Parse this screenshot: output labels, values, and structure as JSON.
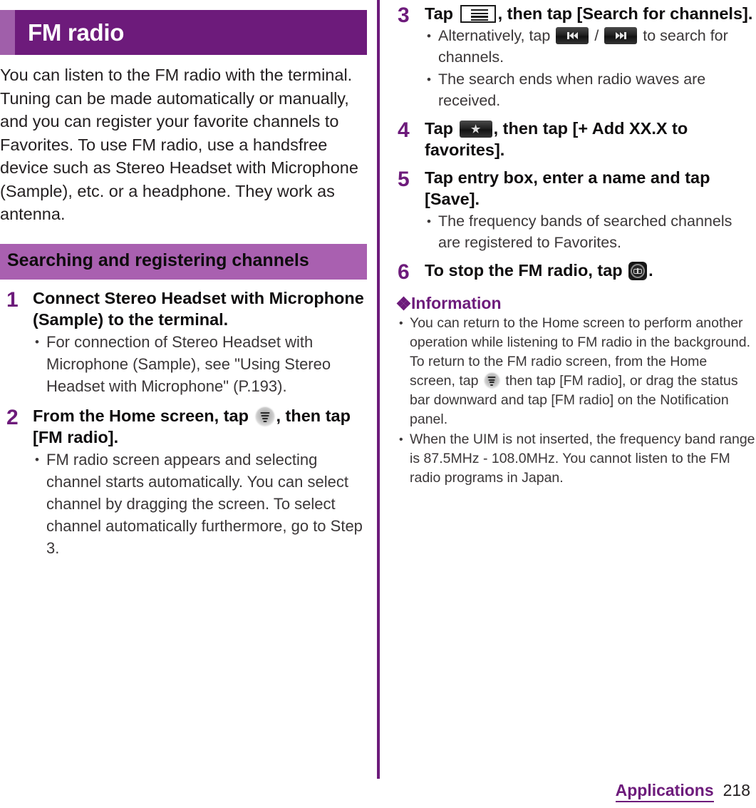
{
  "chapter": {
    "title": "FM radio",
    "bar_accent_color": "#a05faa",
    "bar_main_color": "#6d1b7b"
  },
  "intro": "You can listen to the FM radio with the terminal. Tuning can be made automatically or manually, and you can register your favorite channels to Favorites. To use FM radio, use a handsfree device such as Stereo Headset with Microphone (Sample), etc. or a headphone. They work as antenna.",
  "section": {
    "title": "Searching and registering channels",
    "bar_color": "#a960b0"
  },
  "steps": {
    "step1": {
      "num": "1",
      "head": "Connect Stereo Headset with Microphone (Sample) to the terminal.",
      "bullets": [
        "For connection of Stereo Headset with Microphone (Sample), see \"Using Stereo Headset with Microphone\" (P.193)."
      ]
    },
    "step2": {
      "num": "2",
      "head_before": "From the Home screen, tap",
      "head_after": ", then tap [FM radio].",
      "icon": "app-drawer-icon",
      "bullets": [
        "FM radio screen appears and selecting channel starts automatically. You can select channel by dragging the screen. To select channel automatically furthermore, go to Step 3."
      ]
    },
    "step3": {
      "num": "3",
      "head_before": "Tap",
      "head_after": ", then tap [Search for channels].",
      "icon": "menu-icon",
      "bullet1_before": "Alternatively, tap",
      "bullet1_mid": "/",
      "bullet1_after": "to search for channels.",
      "bullet1_icon_a": "previous-track-icon",
      "bullet1_icon_b": "next-track-icon",
      "bullet2": "The search ends when radio waves are received."
    },
    "step4": {
      "num": "4",
      "head_before": "Tap",
      "head_after": ", then tap [+ Add XX.X to favorites].",
      "icon": "favorite-star-icon"
    },
    "step5": {
      "num": "5",
      "head": "Tap entry box, enter a name and tap [Save].",
      "bullets": [
        "The frequency bands of searched channels are registered to Favorites."
      ]
    },
    "step6": {
      "num": "6",
      "head_before": "To stop the FM radio, tap",
      "head_after": ".",
      "icon": "fm-radio-stop-icon"
    }
  },
  "information": {
    "title": "Information",
    "items": {
      "item1_a": "You can return to the Home screen to perform another operation while listening to FM radio in the background. To return to the FM radio screen, from the Home screen, tap",
      "item1_icon": "app-drawer-icon",
      "item1_b": "then tap [FM radio], or drag the status bar downward and tap [FM radio] on the Notification panel.",
      "item2": "When the UIM is not inserted, the frequency band range is 87.5MHz - 108.0MHz. You cannot listen to the FM radio programs in Japan."
    }
  },
  "footer": {
    "chapter_label": "Applications",
    "page_number": "218",
    "color": "#6d1b7b"
  }
}
